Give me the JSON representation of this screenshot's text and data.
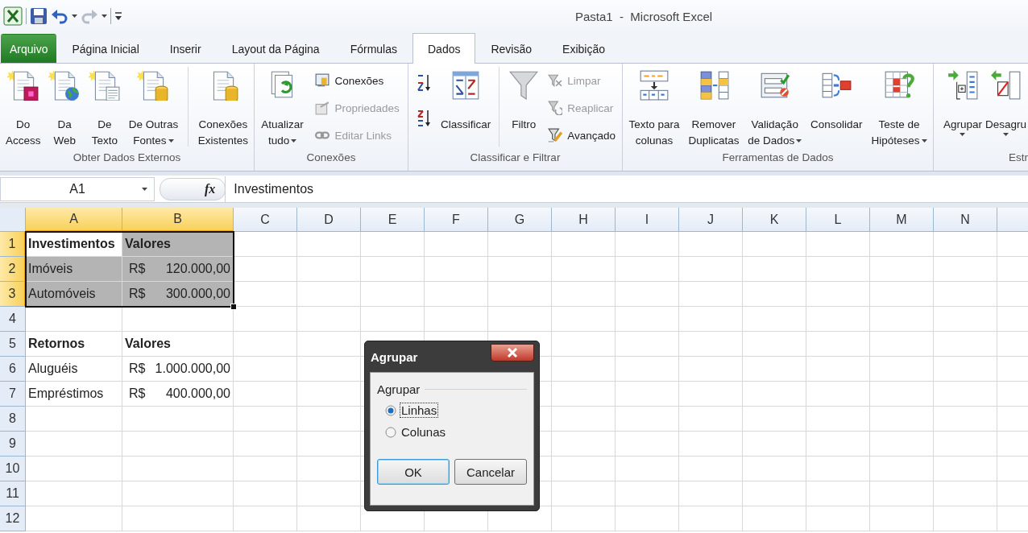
{
  "title_bar": {
    "title": "Pasta1  -  Microsoft Excel"
  },
  "tabs": [
    {
      "label": "Arquivo",
      "kind": "file",
      "selected": false
    },
    {
      "label": "Página Inicial",
      "kind": "tab",
      "selected": false
    },
    {
      "label": "Inserir",
      "kind": "tab",
      "selected": false
    },
    {
      "label": "Layout da Página",
      "kind": "tab",
      "selected": false
    },
    {
      "label": "Fórmulas",
      "kind": "tab",
      "selected": false
    },
    {
      "label": "Dados",
      "kind": "tab",
      "selected": true
    },
    {
      "label": "Revisão",
      "kind": "tab",
      "selected": false
    },
    {
      "label": "Exibição",
      "kind": "tab",
      "selected": false
    }
  ],
  "ribbon": {
    "groups": [
      {
        "label": "Obter Dados Externos",
        "items": [
          {
            "kind": "large",
            "lines": [
              "Do",
              "Access"
            ],
            "dropdown": false
          },
          {
            "kind": "large",
            "lines": [
              "Da",
              "Web"
            ],
            "dropdown": false
          },
          {
            "kind": "large",
            "lines": [
              "De",
              "Texto"
            ],
            "dropdown": false
          },
          {
            "kind": "large",
            "lines": [
              "De Outras",
              "Fontes"
            ],
            "dropdown": true
          },
          {
            "kind": "large",
            "lines": [
              "Conexões",
              "Existentes"
            ],
            "dropdown": false,
            "divider_before": true
          }
        ]
      },
      {
        "label": "Conexões",
        "items": [
          {
            "kind": "large",
            "lines": [
              "Atualizar",
              "tudo"
            ],
            "dropdown": true
          },
          {
            "kind": "stack",
            "items": [
              {
                "label": "Conexões",
                "disabled": false
              },
              {
                "label": "Propriedades",
                "disabled": true
              },
              {
                "label": "Editar Links",
                "disabled": true
              }
            ]
          }
        ]
      },
      {
        "label": "Classificar e Filtrar",
        "items": [
          {
            "kind": "sort-buttons"
          },
          {
            "kind": "large",
            "lines": [
              "Classificar"
            ],
            "dropdown": false
          },
          {
            "kind": "large",
            "lines": [
              "Filtro"
            ],
            "dropdown": false,
            "divider_before": true
          },
          {
            "kind": "stack",
            "items": [
              {
                "label": "Limpar",
                "disabled": true
              },
              {
                "label": "Reaplicar",
                "disabled": true
              },
              {
                "label": "Avançado",
                "disabled": false
              }
            ]
          }
        ]
      },
      {
        "label": "Ferramentas de Dados",
        "items": [
          {
            "kind": "large",
            "lines": [
              "Texto para",
              "colunas"
            ],
            "dropdown": false
          },
          {
            "kind": "large",
            "lines": [
              "Remover",
              "Duplicatas"
            ],
            "dropdown": false
          },
          {
            "kind": "large",
            "lines": [
              "Validação",
              "de Dados"
            ],
            "dropdown": true
          },
          {
            "kind": "large",
            "lines": [
              "Consolidar"
            ],
            "dropdown": false
          },
          {
            "kind": "large",
            "lines": [
              "Teste de",
              "Hipóteses"
            ],
            "dropdown": true
          }
        ]
      },
      {
        "label": "Estr",
        "items": [
          {
            "kind": "large",
            "lines": [
              "Agrupar"
            ],
            "dropdown": true
          },
          {
            "kind": "large",
            "lines": [
              "Desagru"
            ],
            "dropdown": true
          }
        ]
      }
    ]
  },
  "formula_bar": {
    "name_box": "A1",
    "function_label": "fx",
    "formula": "Investimentos"
  },
  "sheet": {
    "columns": [
      {
        "label": "A",
        "selected": true
      },
      {
        "label": "B",
        "selected": true
      },
      {
        "label": "C",
        "selected": false
      },
      {
        "label": "D",
        "selected": false
      },
      {
        "label": "E",
        "selected": false
      },
      {
        "label": "F",
        "selected": false
      },
      {
        "label": "G",
        "selected": false
      },
      {
        "label": "H",
        "selected": false
      },
      {
        "label": "I",
        "selected": false
      },
      {
        "label": "J",
        "selected": false
      },
      {
        "label": "K",
        "selected": false
      },
      {
        "label": "L",
        "selected": false
      },
      {
        "label": "M",
        "selected": false
      },
      {
        "label": "N",
        "selected": false
      }
    ],
    "rows": [
      {
        "label": "1",
        "selected": true,
        "cells": [
          {
            "kind": "text",
            "text": "Investimentos",
            "bold": true,
            "selected": true,
            "active": true
          },
          {
            "kind": "text",
            "text": "Valores",
            "bold": true,
            "selected": true,
            "active": false
          }
        ]
      },
      {
        "label": "2",
        "selected": true,
        "cells": [
          {
            "kind": "text",
            "text": "Imóveis",
            "bold": false,
            "selected": true,
            "active": false
          },
          {
            "kind": "currency",
            "symbol": "R$",
            "amount": "120.000,00",
            "selected": true,
            "active": false
          }
        ]
      },
      {
        "label": "3",
        "selected": true,
        "cells": [
          {
            "kind": "text",
            "text": "Automóveis",
            "bold": false,
            "selected": true,
            "active": false
          },
          {
            "kind": "currency",
            "symbol": "R$",
            "amount": "300.000,00",
            "selected": true,
            "active": false
          }
        ]
      },
      {
        "label": "4",
        "selected": false,
        "cells": []
      },
      {
        "label": "5",
        "selected": false,
        "cells": [
          {
            "kind": "text",
            "text": "Retornos",
            "bold": true,
            "selected": false
          },
          {
            "kind": "text",
            "text": "Valores",
            "bold": true,
            "selected": false
          }
        ]
      },
      {
        "label": "6",
        "selected": false,
        "cells": [
          {
            "kind": "text",
            "text": "Aluguéis",
            "bold": false,
            "selected": false
          },
          {
            "kind": "currency",
            "symbol": "R$",
            "amount": "1.000.000,00",
            "selected": false
          }
        ]
      },
      {
        "label": "7",
        "selected": false,
        "cells": [
          {
            "kind": "text",
            "text": "Empréstimos",
            "bold": false,
            "selected": false
          },
          {
            "kind": "currency",
            "symbol": "R$",
            "amount": "400.000,00",
            "selected": false
          }
        ]
      },
      {
        "label": "8",
        "selected": false,
        "cells": []
      },
      {
        "label": "9",
        "selected": false,
        "cells": []
      },
      {
        "label": "10",
        "selected": false,
        "cells": []
      },
      {
        "label": "11",
        "selected": false,
        "cells": []
      },
      {
        "label": "12",
        "selected": false,
        "cells": []
      }
    ]
  },
  "dialog": {
    "title": "Agrupar",
    "group_label": "Agrupar",
    "options": [
      {
        "label": "Linhas",
        "selected": true,
        "focused": true
      },
      {
        "label": "Colunas",
        "selected": false,
        "focused": false
      }
    ],
    "buttons": [
      {
        "label": "OK",
        "default": true
      },
      {
        "label": "Cancelar",
        "default": false
      }
    ]
  }
}
